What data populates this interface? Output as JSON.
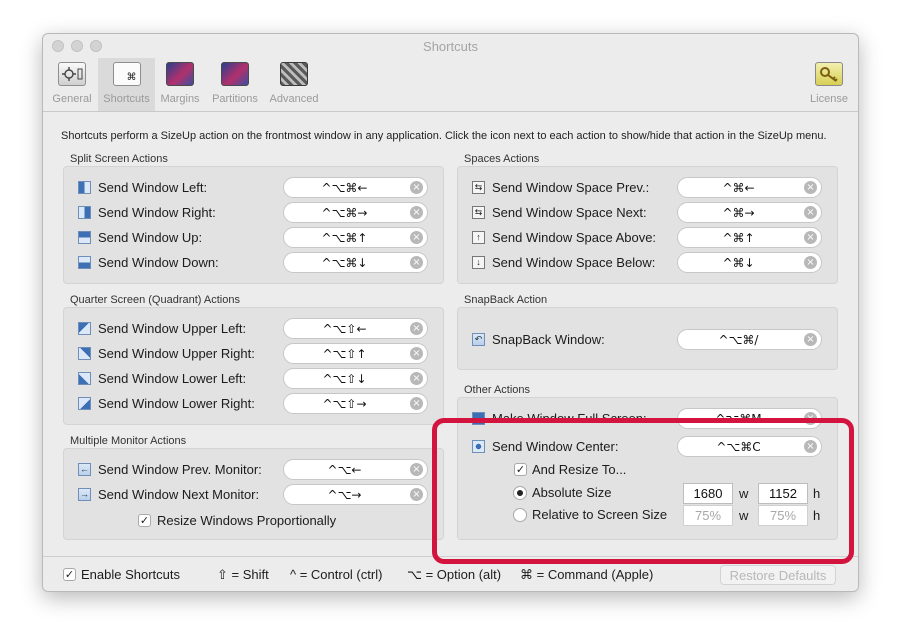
{
  "window": {
    "title": "Shortcuts"
  },
  "toolbar": {
    "items": [
      {
        "label": "General",
        "icon": "general-icon"
      },
      {
        "label": "Shortcuts",
        "icon": "keyboard-shortcut-icon",
        "selected": true
      },
      {
        "label": "Margins",
        "icon": "margins-icon"
      },
      {
        "label": "Partitions",
        "icon": "partitions-icon"
      },
      {
        "label": "Advanced",
        "icon": "advanced-icon"
      },
      {
        "label": "License",
        "icon": "key-icon"
      }
    ]
  },
  "description": "Shortcuts perform a SizeUp action on the frontmost window in any application. Click the icon next to each action to show/hide that action in the SizeUp menu.",
  "split_screen": {
    "title": "Split Screen Actions",
    "rows": [
      {
        "label": "Send Window Left:",
        "shortcut": "^⌥⌘←"
      },
      {
        "label": "Send Window Right:",
        "shortcut": "^⌥⌘→"
      },
      {
        "label": "Send Window Up:",
        "shortcut": "^⌥⌘↑"
      },
      {
        "label": "Send Window Down:",
        "shortcut": "^⌥⌘↓"
      }
    ]
  },
  "quarter_screen": {
    "title": "Quarter Screen (Quadrant) Actions",
    "rows": [
      {
        "label": "Send Window Upper Left:",
        "shortcut": "^⌥⇧←"
      },
      {
        "label": "Send Window Upper Right:",
        "shortcut": "^⌥⇧↑"
      },
      {
        "label": "Send Window Lower Left:",
        "shortcut": "^⌥⇧↓"
      },
      {
        "label": "Send Window Lower Right:",
        "shortcut": "^⌥⇧→"
      }
    ]
  },
  "multi_monitor": {
    "title": "Multiple Monitor Actions",
    "rows": [
      {
        "label": "Send Window Prev. Monitor:",
        "shortcut": "^⌥←"
      },
      {
        "label": "Send Window Next Monitor:",
        "shortcut": "^⌥→"
      }
    ],
    "resize_checkbox": {
      "label": "Resize Windows Proportionally",
      "checked": true
    }
  },
  "spaces": {
    "title": "Spaces Actions",
    "rows": [
      {
        "label": "Send Window Space Prev.:",
        "shortcut": "^⌘←"
      },
      {
        "label": "Send Window Space Next:",
        "shortcut": "^⌘→"
      },
      {
        "label": "Send Window Space Above:",
        "shortcut": "^⌘↑"
      },
      {
        "label": "Send Window Space Below:",
        "shortcut": "^⌘↓"
      }
    ]
  },
  "snapback": {
    "title": "SnapBack Action",
    "rows": [
      {
        "label": "SnapBack Window:",
        "shortcut": "^⌥⌘/"
      }
    ]
  },
  "other": {
    "title": "Other Actions",
    "rows": [
      {
        "label": "Make Window Full Screen:",
        "shortcut": "^⌥⌘M"
      },
      {
        "label": "Send Window Center:",
        "shortcut": "^⌥⌘C"
      }
    ],
    "resize_to": {
      "label": "And Resize To...",
      "checked": true
    },
    "absolute": {
      "label": "Absolute Size",
      "selected": true,
      "width": "1680",
      "height": "1152",
      "w": "w",
      "h": "h"
    },
    "relative": {
      "label": "Relative to Screen Size",
      "selected": false,
      "width": "75%",
      "height": "75%",
      "w": "w",
      "h": "h"
    }
  },
  "footer": {
    "enable": {
      "label": "Enable Shortcuts",
      "checked": true
    },
    "legend": [
      "⇧ = Shift",
      "^ = Control (ctrl)",
      "⌥ = Option (alt)",
      "⌘ = Command (Apple)"
    ],
    "restore_label": "Restore Defaults"
  },
  "colors": {
    "highlight": "#d3143f",
    "panel": "#e2e2e2",
    "window": "#ececec"
  }
}
